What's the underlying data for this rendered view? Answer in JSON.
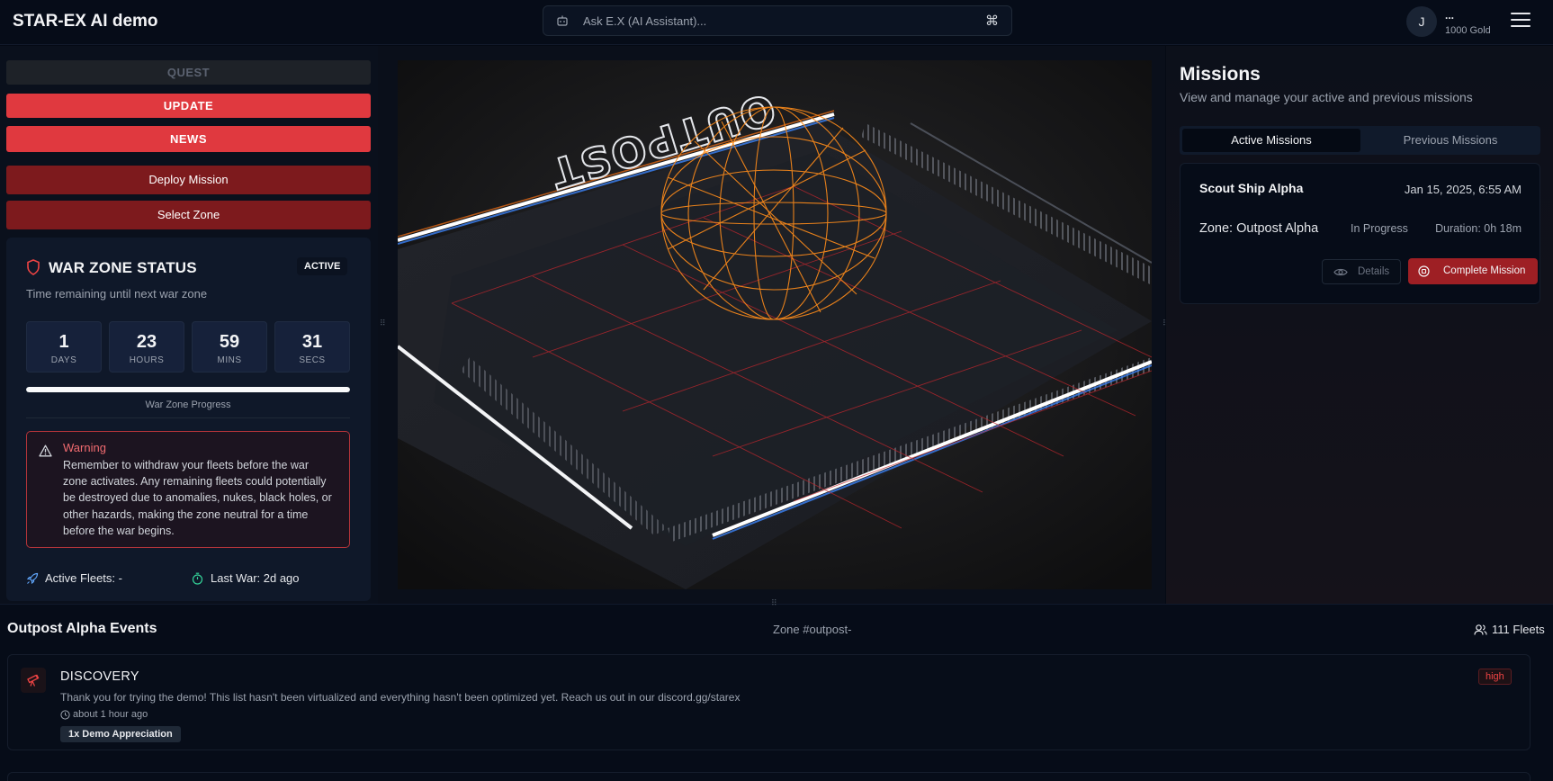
{
  "header": {
    "app_title": "STAR-EX AI demo",
    "search_placeholder": "Ask E.X (AI Assistant)...",
    "shortcut": "⌘",
    "user": {
      "initial": "J",
      "name": "...",
      "gold": "1000 Gold"
    }
  },
  "left": {
    "buttons": {
      "quest": "QUEST",
      "update": "UPDATE",
      "news": "NEWS",
      "deploy": "Deploy Mission",
      "select_zone": "Select Zone"
    },
    "war_zone": {
      "title": "WAR ZONE STATUS",
      "badge": "ACTIVE",
      "subtitle": "Time remaining until next war zone",
      "timer": [
        {
          "value": "1",
          "unit": "DAYS"
        },
        {
          "value": "23",
          "unit": "HOURS"
        },
        {
          "value": "59",
          "unit": "MINS"
        },
        {
          "value": "31",
          "unit": "SECS"
        }
      ],
      "progress_percent": 100,
      "progress_label": "War Zone Progress",
      "warning": {
        "title": "Warning",
        "body": "Remember to withdraw your fleets before the war zone activates. Any remaining fleets could potentially be destroyed due to anomalies, nukes, black holes, or other hazards, making the zone neutral for a time before the war begins."
      },
      "active_fleets": "Active Fleets: -",
      "last_war": "Last War: 2d ago"
    }
  },
  "scene": {
    "label": "OUTPOST"
  },
  "missions": {
    "title": "Missions",
    "subtitle": "View and manage your active and previous missions",
    "tabs": {
      "active": "Active Missions",
      "previous": "Previous Missions"
    },
    "card": {
      "name": "Scout Ship Alpha",
      "date": "Jan 15, 2025, 6:55 AM",
      "zone": "Zone: Outpost Alpha",
      "status": "In Progress",
      "duration": "Duration: 0h 18m",
      "details_label": "Details",
      "complete_label": "Complete Mission"
    }
  },
  "events": {
    "title": "Outpost Alpha Events",
    "zone": "Zone #outpost-",
    "fleets": "111 Fleets",
    "items": [
      {
        "type": "DISCOVERY",
        "description": "Thank you for trying the demo! This list hasn't been virtualized and everything hasn't been optimized yet. Reach us out in our discord.gg/starex",
        "time": "about 1 hour ago",
        "tag": "1x Demo Appreciation",
        "priority": "high"
      }
    ]
  },
  "colors": {
    "accent_red": "#e0393f",
    "dark_red": "#7d1a1d",
    "background": "#050a14",
    "wireframe_orange": "#ff8c1a"
  }
}
